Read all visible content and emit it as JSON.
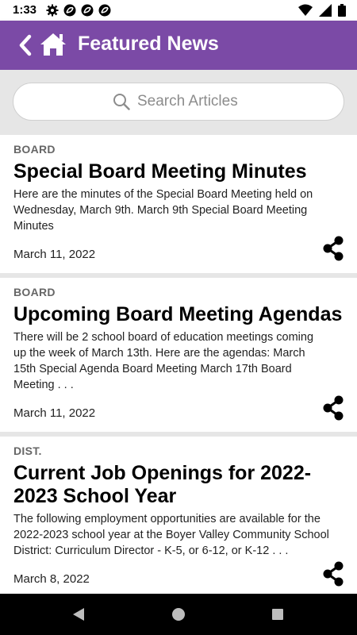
{
  "status_bar": {
    "time": "1:33",
    "left_icons": [
      "gear-icon",
      "app-notification-icon",
      "app-notification-icon",
      "app-notification-icon"
    ],
    "right_icons": [
      "wifi-icon",
      "signal-icon",
      "battery-icon"
    ]
  },
  "app_bar": {
    "title": "Featured News",
    "back_icon": "chevron-left-icon",
    "home_icon": "home-icon",
    "color": "#7b4aa6"
  },
  "search": {
    "placeholder": "Search Articles",
    "icon": "search-icon"
  },
  "articles": [
    {
      "category": "BOARD",
      "title_lines": [
        "Special Board Meeting Minutes"
      ],
      "summary_lines": [
        "Here are the minutes of the Special Board Meeting held on",
        "Wednesday, March 9th. March 9th Special Board Meeting",
        "Minutes"
      ],
      "date": "March 11, 2022"
    },
    {
      "category": "BOARD",
      "title_lines": [
        "Upcoming Board Meeting Agendas"
      ],
      "summary_lines": [
        "There will be 2 school board of education meetings coming",
        "up the week of March 13th.  Here are the agendas: March",
        "15th Special Agenda Board Meeting March 17th Board",
        "Meeting . . ."
      ],
      "date": "March 11, 2022"
    },
    {
      "category": "DIST.",
      "title_lines": [
        "Current Job Openings for 2022-",
        "2023 School Year"
      ],
      "summary_lines": [
        "The following employment opportunities are available for the",
        "2022-2023 school year at the Boyer Valley Community School",
        "District: Curriculum Director - K-5, or 6-12, or K-12 . . ."
      ],
      "date": "March 8, 2022"
    }
  ],
  "nav_bar": {
    "buttons": [
      "back-triangle-icon",
      "home-circle-icon",
      "recents-square-icon"
    ]
  }
}
